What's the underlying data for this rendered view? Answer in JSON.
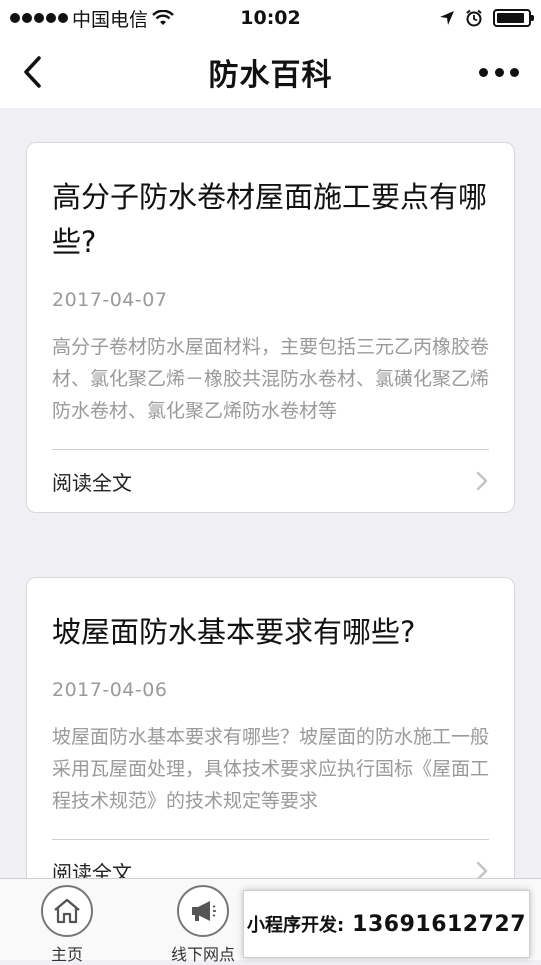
{
  "status_bar": {
    "carrier": "中国电信",
    "time": "10:02",
    "battery_level": 0.9
  },
  "nav": {
    "title": "防水百科"
  },
  "articles": [
    {
      "title": "高分子防水卷材屋面施工要点有哪些?",
      "date": "2017-04-07",
      "excerpt": "高分子卷材防水屋面材料，主要包括三元乙丙橡胶卷材、氯化聚乙烯－橡胶共混防水卷材、氯磺化聚乙烯防水卷材、氯化聚乙烯防水卷材等",
      "read_more": "阅读全文"
    },
    {
      "title": "坡屋面防水基本要求有哪些?",
      "date": "2017-04-06",
      "excerpt": "坡屋面防水基本要求有哪些？坡屋面的防水施工一般采用瓦屋面处理，具体技术要求应执行国标《屋面工程技术规范》的技术规定等要求",
      "read_more": "阅读全文"
    }
  ],
  "tabbar": {
    "tabs": [
      {
        "label": "主页",
        "icon": "home-icon"
      },
      {
        "label": "线下网点",
        "icon": "megaphone-icon"
      }
    ]
  },
  "promo": {
    "label": "小程序开发:",
    "phone": "13691612727"
  }
}
